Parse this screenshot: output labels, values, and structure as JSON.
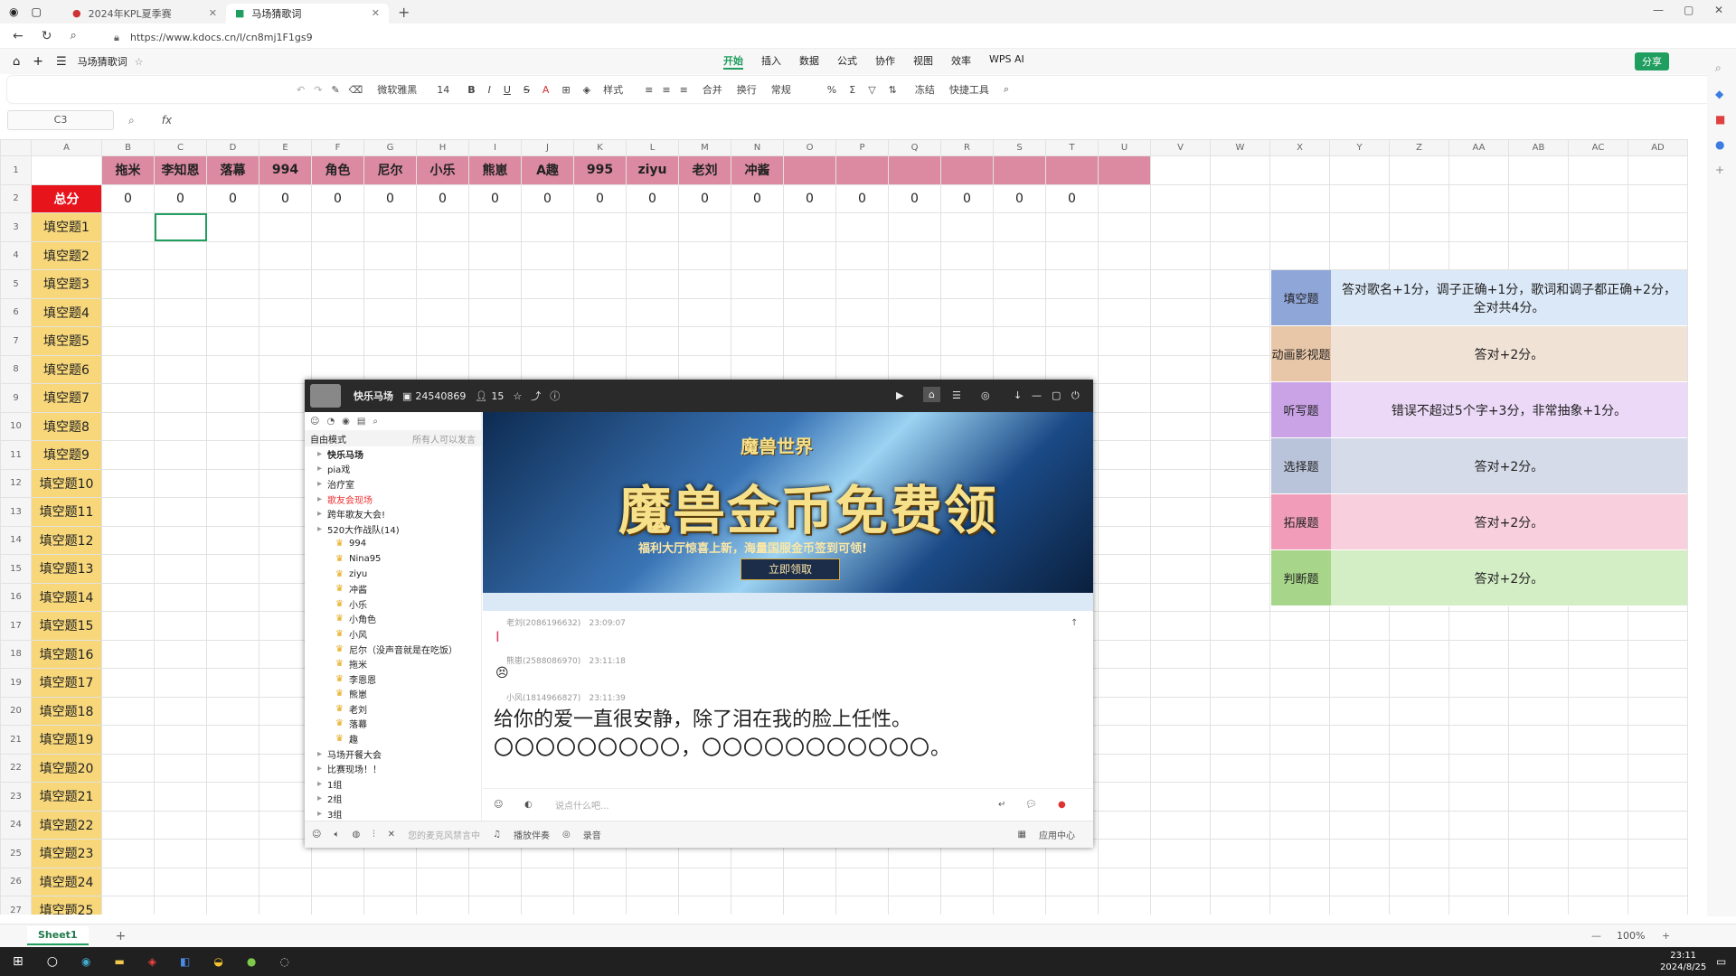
{
  "browser": {
    "tabs": [
      {
        "label": "2024年KPL夏季赛"
      },
      {
        "label": "马场猜歌词"
      }
    ],
    "url": "https://www.kdocs.cn/l/cn8mj1F1gs9"
  },
  "app": {
    "doc_name": "马场猜歌词",
    "menu": [
      "开始",
      "插入",
      "数据",
      "公式",
      "协作",
      "视图",
      "效率",
      "WPS AI"
    ],
    "share_label": "分享"
  },
  "ribbon": {
    "font": "微软雅黑",
    "size": "14",
    "style_label": "样式",
    "merge_label": "合并",
    "wrap_label": "换行",
    "format_label": "常规",
    "freeze_label": "冻结",
    "tools_label": "快捷工具"
  },
  "formula": {
    "cell_ref": "C3",
    "fx": "fx"
  },
  "sheet": {
    "columns": [
      "A",
      "B",
      "C",
      "D",
      "E",
      "F",
      "G",
      "H",
      "I",
      "J",
      "K",
      "L",
      "M",
      "N",
      "O",
      "P",
      "Q",
      "R",
      "S",
      "T",
      "U",
      "V",
      "W",
      "X",
      "Y",
      "Z",
      "AA",
      "AB",
      "AC",
      "AD"
    ],
    "players": [
      "拖米",
      "李知恩",
      "落幕",
      "994",
      "角色",
      "尼尔",
      "小乐",
      "熊崽",
      "A趣",
      "995",
      "ziyu",
      "老刘",
      "冲酱"
    ],
    "total_label": "总分",
    "scores": [
      "0",
      "0",
      "0",
      "0",
      "0",
      "0",
      "0",
      "0",
      "0",
      "0",
      "0",
      "0",
      "0",
      "0",
      "0",
      "0",
      "0",
      "0",
      "0"
    ],
    "questions": [
      "填空题1",
      "填空题2",
      "填空题3",
      "填空题4",
      "填空题5",
      "填空题6",
      "填空题7",
      "填空题8",
      "填空题9",
      "填空题10",
      "填空题11",
      "填空题12",
      "填空题13",
      "填空题14",
      "填空题15",
      "填空题16",
      "填空题17",
      "填空题18",
      "填空题19",
      "填空题20",
      "填空题21",
      "填空题22",
      "填空题23",
      "填空题24",
      "填空题25"
    ]
  },
  "legend": [
    {
      "type": "填空题",
      "rule": "答对歌名+1分，调子正确+1分，歌词和调子都正确+2分，全对共4分。",
      "color": "#8fa6d8",
      "bg": "#dbe8f7"
    },
    {
      "type": "动画影视题",
      "rule": "答对+2分。",
      "color": "#e8c6a8",
      "bg": "#f1e2d6"
    },
    {
      "type": "听写题",
      "rule": "错误不超过5个字+3分，非常抽象+1分。",
      "color": "#c9a3e6",
      "bg": "#ecd9f8"
    },
    {
      "type": "选择题",
      "rule": "答对+2分。",
      "color": "#b9c3d9",
      "bg": "#d5dbe8"
    },
    {
      "type": "拓展题",
      "rule": "答对+2分。",
      "color": "#f19dba",
      "bg": "#f7cfdd"
    },
    {
      "type": "判断题",
      "rule": "答对+2分。",
      "color": "#a7d68a",
      "bg": "#d3edc4"
    }
  ],
  "sheet_tab": "Sheet1",
  "zoom": "100%",
  "chat": {
    "room": "快乐马场",
    "room_id": "24540869",
    "members": "15",
    "mode": "自由模式",
    "mode_note": "所有人可以发言",
    "channels": [
      {
        "name": "快乐马场",
        "sub": false
      },
      {
        "name": "pia戏",
        "sub": false
      },
      {
        "name": "治疗室",
        "sub": false
      },
      {
        "name": "歌友会现场",
        "sub": false
      },
      {
        "name": "跨年歌友大会!",
        "sub": false
      },
      {
        "name": "520大作战队(14)",
        "sub": false
      },
      {
        "name": "994",
        "sub": true
      },
      {
        "name": "Nina95",
        "sub": true
      },
      {
        "name": "ziyu",
        "sub": true
      },
      {
        "name": "冲酱",
        "sub": true
      },
      {
        "name": "小乐",
        "sub": true
      },
      {
        "name": "小角色",
        "sub": true
      },
      {
        "name": "小风",
        "sub": true
      },
      {
        "name": "尼尔（没声音就是在吃饭）",
        "sub": true
      },
      {
        "name": "拖米",
        "sub": true
      },
      {
        "name": "李恩恩",
        "sub": true
      },
      {
        "name": "熊崽",
        "sub": true
      },
      {
        "name": "老刘",
        "sub": true
      },
      {
        "name": "落幕",
        "sub": true
      },
      {
        "name": "趣",
        "sub": true
      },
      {
        "name": "马场开餐大会",
        "sub": false
      },
      {
        "name": "比赛现场！！",
        "sub": false
      },
      {
        "name": "1组",
        "sub": false
      },
      {
        "name": "2组",
        "sub": false
      },
      {
        "name": "3组",
        "sub": false
      }
    ],
    "banner_logo": "魔兽世界",
    "banner_title": "魔兽金币免费领",
    "banner_sub": "福利大厅惊喜上新，海量国服金币签到可领!",
    "banner_btn": "立即领取",
    "messages": [
      {
        "user": "老刘(2086196632)",
        "time": "23:09:07",
        "text": "I"
      },
      {
        "user": "熊崽(2588086970)",
        "time": "23:11:18",
        "text": ""
      },
      {
        "user": "小风(1814966827)",
        "time": "23:11:39",
        "text": "给你的爱一直很安静，除了泪在我的脸上任性。"
      }
    ],
    "lyric_blanks": "〇〇〇〇〇〇〇〇〇，〇〇〇〇〇〇〇〇〇〇〇。",
    "input_placeholder": "说点什么吧...",
    "footer": [
      "您的麦克风禁言中",
      "播放伴奏",
      "录音",
      "应用中心"
    ]
  },
  "clock": {
    "time": "23:11",
    "date": "2024/8/25"
  }
}
